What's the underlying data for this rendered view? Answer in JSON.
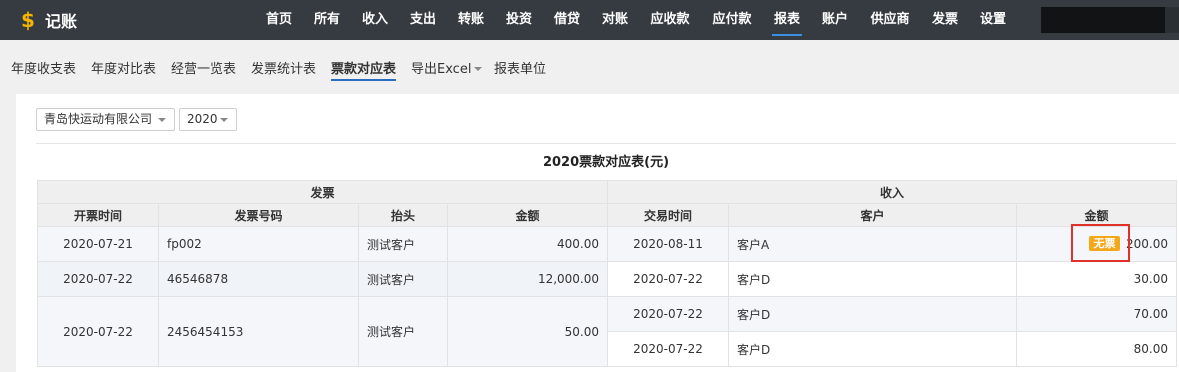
{
  "app": {
    "title": "记账",
    "logo_icon": "$"
  },
  "nav": {
    "items": [
      "首页",
      "所有",
      "收入",
      "支出",
      "转账",
      "投资",
      "借贷",
      "对账",
      "应收款",
      "应付款",
      "报表",
      "账户",
      "供应商",
      "发票",
      "设置"
    ],
    "active": "报表"
  },
  "subnav": {
    "items": [
      "年度收支表",
      "年度对比表",
      "经营一览表",
      "发票统计表",
      "票款对应表",
      "导出Excel",
      "报表单位"
    ],
    "active": "票款对应表"
  },
  "filters": {
    "company": "青岛快运动有限公司",
    "year": "2020"
  },
  "report": {
    "title": "2020票款对应表(元)",
    "invoice_section": "发票",
    "income_section": "收入",
    "invoice_headers": [
      "开票时间",
      "发票号码",
      "抬头",
      "金额"
    ],
    "income_headers": [
      "交易时间",
      "客户",
      "金额"
    ],
    "invoices": [
      {
        "date": "2020-07-21",
        "number": "fp002",
        "title": "测试客户",
        "amount": "400.00"
      },
      {
        "date": "2020-07-22",
        "number": "46546878",
        "title": "测试客户",
        "amount": "12,000.00"
      },
      {
        "date": "2020-07-22",
        "number": "2456454153",
        "title": "测试客户",
        "amount": "50.00"
      }
    ],
    "incomes": [
      {
        "date": "2020-08-11",
        "customer": "客户A",
        "amount": "200.00",
        "badge": "无票"
      },
      {
        "date": "2020-07-22",
        "customer": "客户D",
        "amount": "30.00"
      },
      {
        "date": "2020-07-22",
        "customer": "客户D",
        "amount": "70.00"
      },
      {
        "date": "2020-07-22",
        "customer": "客户D",
        "amount": "80.00"
      }
    ]
  },
  "colors": {
    "topbar": "#353b40",
    "accent": "#3b8fe0",
    "amount": "#2d55a6",
    "badge": "#f3a81c",
    "highlight": "#e0302a"
  }
}
